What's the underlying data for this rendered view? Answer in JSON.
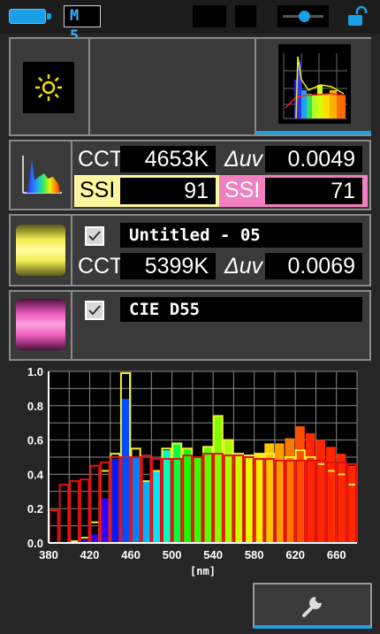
{
  "status_bar": {
    "memory_label": "M 5"
  },
  "panel_top": {
    "mode_icon": "sun-icon",
    "thumbnail_icon": "spectrum-thumbnail-icon"
  },
  "measurement": {
    "icon": "spectrum-icon",
    "cct_label": "CCT",
    "cct_value": "4653K",
    "duv_label": "Δuv",
    "duv_value": "0.0049",
    "ssi_label_a": "SSI",
    "ssi_value_a": "91",
    "ssi_label_b": "SSI",
    "ssi_value_b": "71"
  },
  "reference_1": {
    "swatch_color": "#f3ef52",
    "checked": true,
    "name": "Untitled - 05",
    "cct_label": "CCT",
    "cct_value": "5399K",
    "duv_label": "Δuv",
    "duv_value": "0.0069"
  },
  "reference_2": {
    "swatch_color": "#f060c0",
    "checked": true,
    "name": "CIE D55"
  },
  "toolbar": {
    "settings_icon": "wrench-icon"
  },
  "chart_data": {
    "type": "bar",
    "xlabel": "[nm]",
    "ylabel": "",
    "xlim": [
      380,
      680
    ],
    "ylim": [
      0,
      1.0
    ],
    "x_ticks": [
      "380",
      "420",
      "460",
      "500",
      "540",
      "580",
      "620",
      "660"
    ],
    "y_ticks": [
      "0.0",
      "0.2",
      "0.4",
      "0.6",
      "0.8",
      "1.0"
    ],
    "grid": true,
    "x": [
      385,
      395,
      405,
      415,
      425,
      435,
      445,
      455,
      465,
      475,
      485,
      495,
      505,
      515,
      525,
      535,
      545,
      555,
      565,
      575,
      585,
      595,
      605,
      615,
      625,
      635,
      645,
      655,
      665,
      675
    ],
    "series": [
      {
        "values": [
          0.0,
          0.0,
          0.01,
          0.02,
          0.05,
          0.26,
          0.49,
          0.84,
          0.5,
          0.36,
          0.42,
          0.54,
          0.58,
          0.55,
          0.5,
          0.56,
          0.74,
          0.6,
          0.52,
          0.51,
          0.52,
          0.58,
          0.58,
          0.61,
          0.68,
          0.64,
          0.6,
          0.56,
          0.52,
          0.45
        ]
      },
      {
        "values": [
          0.0,
          0.0,
          0.01,
          0.03,
          0.12,
          0.42,
          0.52,
          0.99,
          0.55,
          0.36,
          0.42,
          0.55,
          0.58,
          0.55,
          0.5,
          0.56,
          0.74,
          0.6,
          0.52,
          0.51,
          0.52,
          0.52,
          0.48,
          0.5,
          0.54,
          0.5,
          0.46,
          0.42,
          0.4,
          0.34
        ]
      },
      {
        "values": [
          0.19,
          0.34,
          0.36,
          0.37,
          0.45,
          0.47,
          0.5,
          0.5,
          0.5,
          0.51,
          0.49,
          0.49,
          0.49,
          0.51,
          0.5,
          0.52,
          0.52,
          0.51,
          0.51,
          0.5,
          0.49,
          0.49,
          0.48,
          0.48,
          0.48,
          0.48,
          0.48,
          0.47,
          0.47,
          0.46
        ]
      }
    ],
    "colors": {
      "outline_ref1": "#f3ef30",
      "outline_ref2": "#e01010",
      "grid": "#8a8a8a",
      "axis": "#ffffff"
    }
  }
}
